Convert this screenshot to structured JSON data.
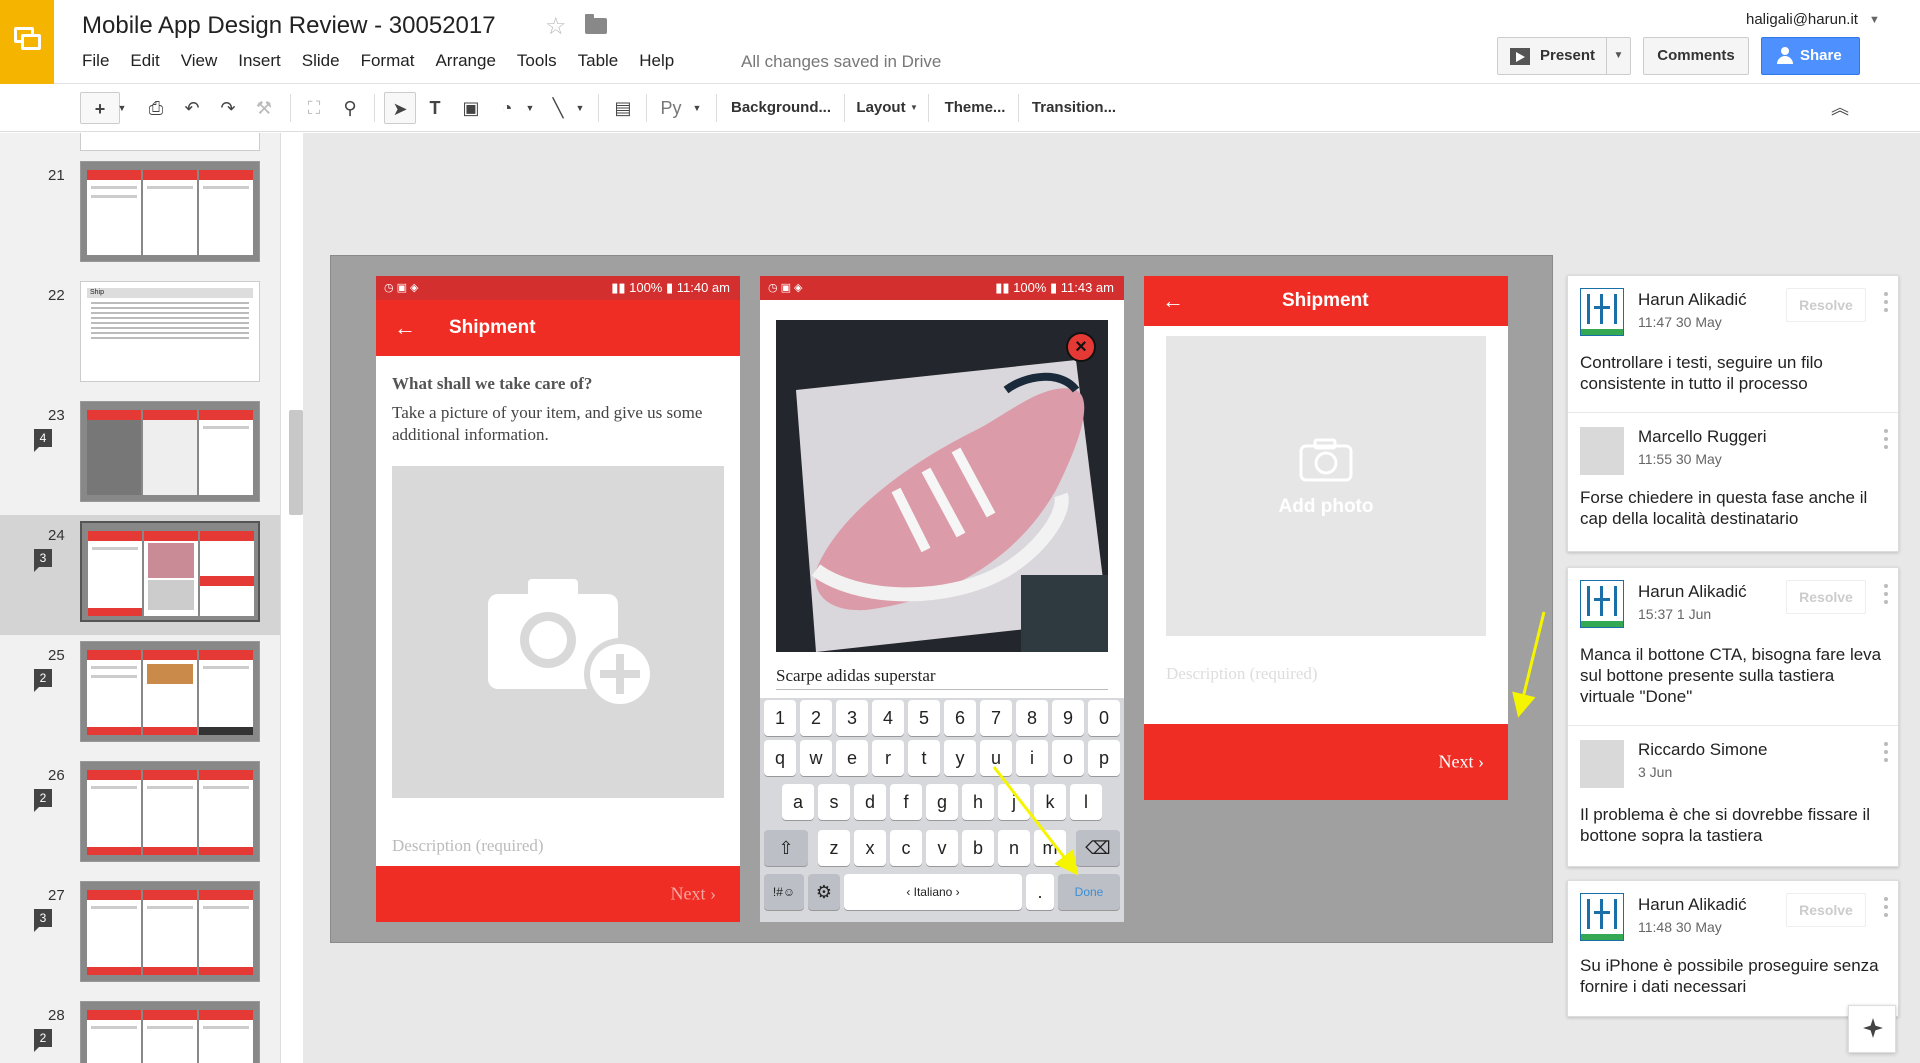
{
  "app": {
    "doc_title": "Mobile App Design Review - 30052017",
    "saved_status": "All changes saved in Drive",
    "account": "haligali@harun.it",
    "brand_color": "#f4b400",
    "menu": [
      "File",
      "Edit",
      "View",
      "Insert",
      "Slide",
      "Format",
      "Arrange",
      "Tools",
      "Table",
      "Help"
    ],
    "buttons": {
      "present": "Present",
      "comments": "Comments",
      "share": "Share"
    }
  },
  "toolbar": {
    "add": "+",
    "font_btn": "Py",
    "background": "Background...",
    "layout": "Layout",
    "theme": "Theme...",
    "transition": "Transition..."
  },
  "filmstrip": [
    {
      "num": "21",
      "badge": ""
    },
    {
      "num": "22",
      "badge": "",
      "title": "Ship"
    },
    {
      "num": "23",
      "badge": "4"
    },
    {
      "num": "24",
      "badge": "3",
      "selected": true
    },
    {
      "num": "25",
      "badge": "2"
    },
    {
      "num": "26",
      "badge": "2"
    },
    {
      "num": "27",
      "badge": "3"
    },
    {
      "num": "28",
      "badge": "2"
    }
  ],
  "slide": {
    "screen1": {
      "status_time": "11:40 am",
      "battery": "100%",
      "title": "Shipment",
      "heading": "What shall we take care of?",
      "body": "Take a picture of your item, and give us some additional information.",
      "description_placeholder": "Description (required)",
      "next": "Next"
    },
    "screen2": {
      "status_time": "11:43 am",
      "battery": "100%",
      "text_input": "Scarpe adidas superstar",
      "keyboard": {
        "row_numbers": [
          "1",
          "2",
          "3",
          "4",
          "5",
          "6",
          "7",
          "8",
          "9",
          "0"
        ],
        "row1": [
          "q",
          "w",
          "e",
          "r",
          "t",
          "y",
          "u",
          "i",
          "o",
          "p"
        ],
        "row2": [
          "a",
          "s",
          "d",
          "f",
          "g",
          "h",
          "j",
          "k",
          "l"
        ],
        "row3": [
          "z",
          "x",
          "c",
          "v",
          "b",
          "n",
          "m"
        ],
        "symbols": "!#☺",
        "language": "Italiano",
        "dot": ".",
        "done": "Done"
      }
    },
    "screen3": {
      "title": "Shipment",
      "add_photo": "Add photo",
      "description_placeholder": "Description (required)",
      "next": "Next"
    },
    "accent_red": "#f02d24"
  },
  "comments": [
    {
      "author": "Harun Alikadić",
      "time": "11:47 30 May",
      "resolve": "Resolve",
      "text": "Controllare i testi, seguire un filo consistente in tutto il processo",
      "avatar": "hn-logo"
    },
    {
      "author": "Marcello Ruggeri",
      "time": "11:55 30 May",
      "text": "Forse chiedere in questa fase anche il cap della località destinatario",
      "avatar": "grey"
    },
    {
      "author": "Harun Alikadić",
      "time": "15:37 1 Jun",
      "resolve": "Resolve",
      "text": "Manca il bottone CTA, bisogna fare leva sul bottone presente sulla tastiera virtuale \"Done\"",
      "avatar": "hn-logo"
    },
    {
      "author": "Riccardo Simone",
      "time": "3 Jun",
      "text": "Il problema è che si dovrebbe fissare il bottone sopra la tastiera",
      "avatar": "grey"
    },
    {
      "author": "Harun Alikadić",
      "time": "11:48 30 May",
      "resolve": "Resolve",
      "text": "Su iPhone è possibile proseguire senza fornire i dati necessari",
      "avatar": "hn-logo"
    }
  ]
}
